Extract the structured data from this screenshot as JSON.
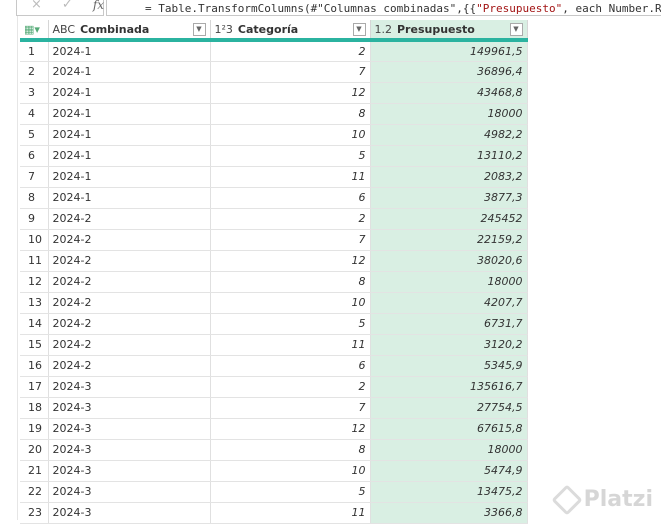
{
  "formula_bar": {
    "cancel_icon": "×",
    "confirm_icon": "✓",
    "fx_label": "fx",
    "formula_prefix": "= Table.TransformColumns(#\"Columnas combinadas\",{{",
    "formula_string": "\"Presupuesto\"",
    "formula_suffix": ", each Number.Ro"
  },
  "table": {
    "columns": [
      {
        "type": "ABC",
        "name": "Combinada"
      },
      {
        "type": "1²3",
        "name": "Categoría"
      },
      {
        "type": "1.2",
        "name": "Presupuesto"
      }
    ],
    "rows": [
      [
        "1",
        "2024-1",
        "2",
        "149961,5"
      ],
      [
        "2",
        "2024-1",
        "7",
        "36896,4"
      ],
      [
        "3",
        "2024-1",
        "12",
        "43468,8"
      ],
      [
        "4",
        "2024-1",
        "8",
        "18000"
      ],
      [
        "5",
        "2024-1",
        "10",
        "4982,2"
      ],
      [
        "6",
        "2024-1",
        "5",
        "13110,2"
      ],
      [
        "7",
        "2024-1",
        "11",
        "2083,2"
      ],
      [
        "8",
        "2024-1",
        "6",
        "3877,3"
      ],
      [
        "9",
        "2024-2",
        "2",
        "245452"
      ],
      [
        "10",
        "2024-2",
        "7",
        "22159,2"
      ],
      [
        "11",
        "2024-2",
        "12",
        "38020,6"
      ],
      [
        "12",
        "2024-2",
        "8",
        "18000"
      ],
      [
        "13",
        "2024-2",
        "10",
        "4207,7"
      ],
      [
        "14",
        "2024-2",
        "5",
        "6731,7"
      ],
      [
        "15",
        "2024-2",
        "11",
        "3120,2"
      ],
      [
        "16",
        "2024-2",
        "6",
        "5345,9"
      ],
      [
        "17",
        "2024-3",
        "2",
        "135616,7"
      ],
      [
        "18",
        "2024-3",
        "7",
        "27754,5"
      ],
      [
        "19",
        "2024-3",
        "12",
        "67615,8"
      ],
      [
        "20",
        "2024-3",
        "8",
        "18000"
      ],
      [
        "21",
        "2024-3",
        "10",
        "5474,9"
      ],
      [
        "22",
        "2024-3",
        "5",
        "13475,2"
      ],
      [
        "23",
        "2024-3",
        "11",
        "3366,8"
      ]
    ]
  },
  "watermark": "Platzi"
}
